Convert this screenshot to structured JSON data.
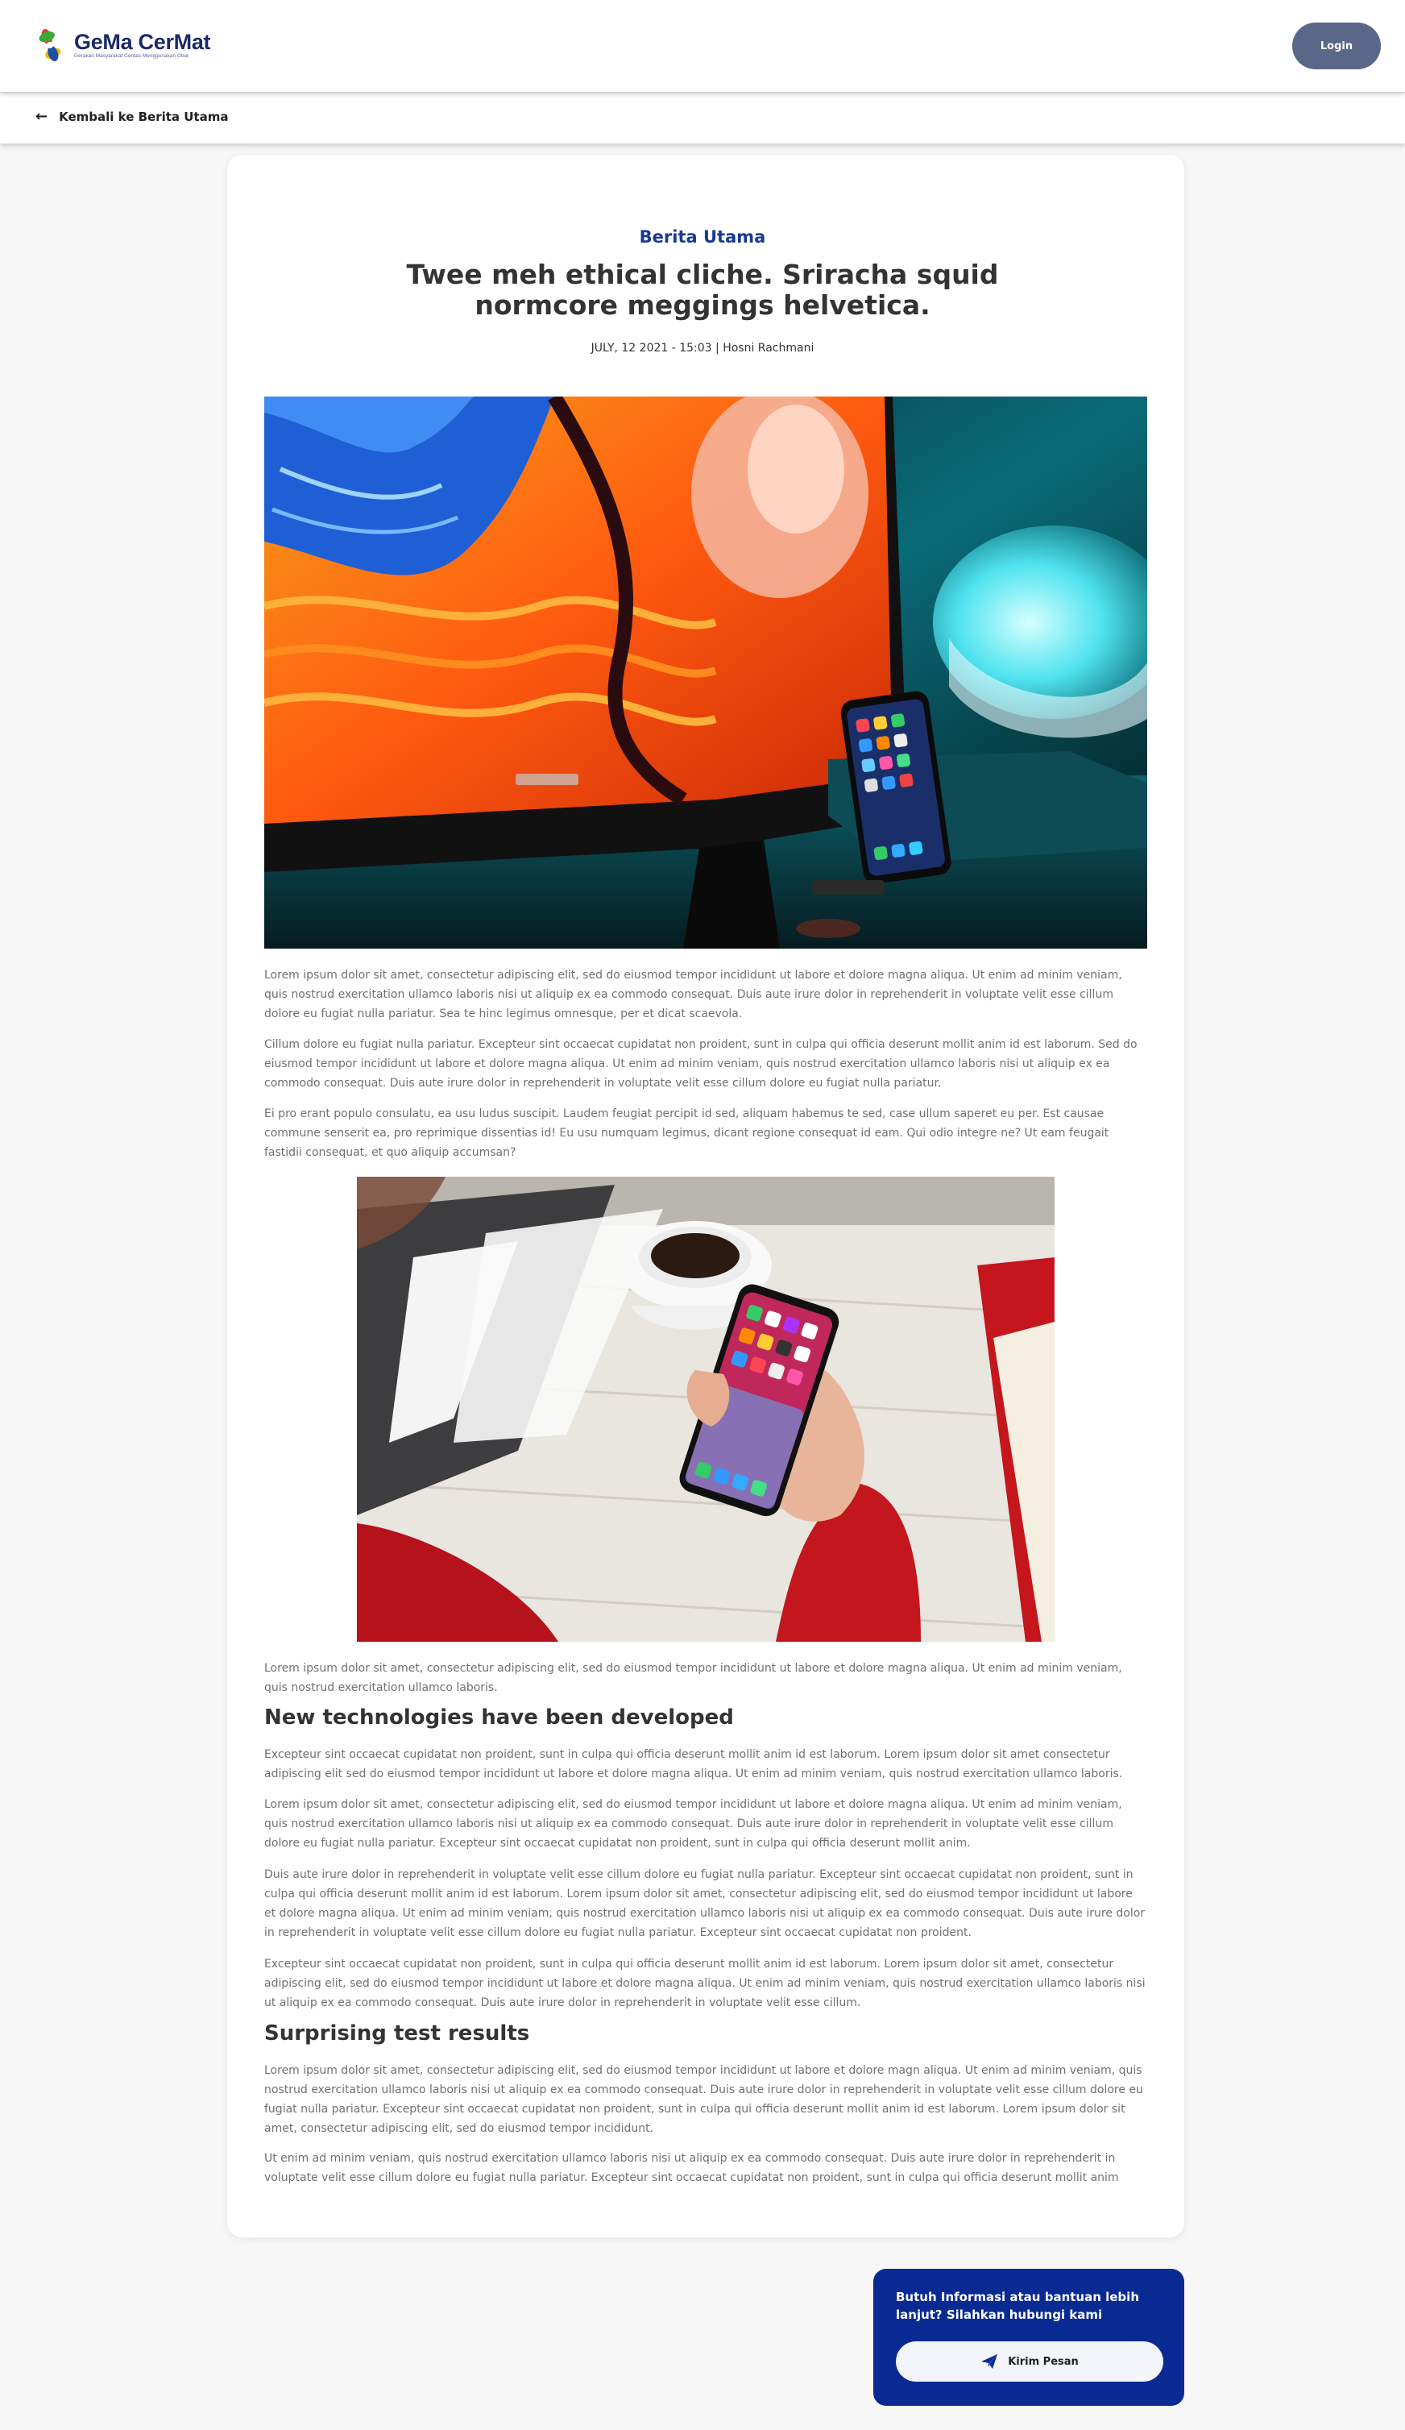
{
  "header": {
    "logo_name": "GeMa CerMat",
    "logo_tagline": "Gerakan Masyarakat Cerdas Menggunakan Obat",
    "login_label": "Login"
  },
  "nav": {
    "back_label": "Kembali ke Berita Utama"
  },
  "article": {
    "category": "Berita Utama",
    "title": "Twee meh ethical cliche. Sriracha squid normcore meggings helvetica.",
    "meta": "JULY, 12 2021 - 15:03 | Hosni Rachmani",
    "paragraphs": [
      "Lorem ipsum dolor sit amet, consectetur adipiscing elit, sed do eiusmod tempor incididunt ut labore et dolore magna aliqua. Ut enim ad minim veniam, quis nostrud exercitation ullamco laboris nisi ut aliquip ex ea commodo consequat. Duis aute irure dolor in reprehenderit in voluptate velit esse cillum dolore eu fugiat nulla pariatur. Sea te hinc legimus omnesque, per et dicat scaevola.",
      "Cillum dolore eu fugiat nulla pariatur. Excepteur sint occaecat cupidatat non proident, sunt in culpa qui officia deserunt mollit anim id est laborum. Sed do eiusmod tempor incididunt ut labore et dolore magna aliqua. Ut enim ad minim veniam, quis nostrud exercitation ullamco laboris nisi ut aliquip ex ea commodo consequat. Duis aute irure dolor in reprehenderit in voluptate velit esse cillum dolore eu fugiat nulla pariatur.",
      "Ei pro erant populo consulatu, ea usu ludus suscipit. Laudem feugiat percipit id sed, aliquam habemus te sed, case ullum saperet eu per. Est causae commune senserit ea, pro reprimique dissentias id! Eu usu numquam legimus, dicant regione consequat id eam. Qui odio integre ne? Ut eam feugait fastidii consequat, et quo aliquip accumsan?",
      "Lorem ipsum dolor sit amet, consectetur adipiscing elit, sed do eiusmod tempor incididunt ut labore et dolore magna aliqua. Ut enim ad minim veniam, quis nostrud exercitation ullamco laboris."
    ],
    "heading1": "New technologies have been developed",
    "section1": [
      "Excepteur sint occaecat cupidatat non proident, sunt in culpa qui officia deserunt mollit anim id est laborum. Lorem ipsum dolor sit amet consectetur adipiscing elit sed do eiusmod tempor incididunt ut labore et dolore magna aliqua. Ut enim ad minim veniam, quis nostrud exercitation ullamco laboris.",
      "Lorem ipsum dolor sit amet, consectetur adipiscing elit, sed do eiusmod tempor incididunt ut labore et dolore magna aliqua. Ut enim ad minim veniam, quis nostrud exercitation ullamco laboris nisi ut aliquip ex ea commodo consequat. Duis aute irure dolor in reprehenderit in voluptate velit esse cillum dolore eu fugiat nulla pariatur. Excepteur sint occaecat cupidatat non proident, sunt in culpa qui officia deserunt mollit anim.",
      "Duis aute irure dolor in reprehenderit in voluptate velit esse cillum dolore eu fugiat nulla pariatur. Excepteur sint occaecat cupidatat non proident, sunt in culpa qui officia deserunt mollit anim id est laborum. Lorem ipsum dolor sit amet, consectetur adipiscing elit, sed do eiusmod tempor incididunt ut labore et dolore magna aliqua. Ut enim ad minim veniam, quis nostrud exercitation ullamco laboris nisi ut aliquip ex ea commodo consequat. Duis aute irure dolor in reprehenderit in voluptate velit esse cillum dolore eu fugiat nulla pariatur. Excepteur sint occaecat cupidatat non proident.",
      "Excepteur sint occaecat cupidatat non proident, sunt in culpa qui officia deserunt mollit anim id est laborum. Lorem ipsum dolor sit amet, consectetur adipiscing elit, sed do eiusmod tempor incididunt ut labore et dolore magna aliqua. Ut enim ad minim veniam, quis nostrud exercitation ullamco laboris nisi ut aliquip ex ea commodo consequat. Duis aute irure dolor in reprehenderit in voluptate velit esse cillum."
    ],
    "heading2": "Surprising test results",
    "section2": [
      "Lorem ipsum dolor sit amet, consectetur adipiscing elit, sed do eiusmod tempor incididunt ut labore et dolore magn aliqua. Ut enim ad minim veniam, quis nostrud exercitation ullamco laboris nisi ut aliquip ex ea commodo consequat. Duis aute irure dolor in reprehenderit in voluptate velit esse cillum dolore eu fugiat nulla pariatur. Excepteur sint occaecat cupidatat non proident, sunt in culpa qui officia deserunt mollit anim id est laborum. Lorem ipsum dolor sit amet, consectetur adipiscing elit, sed do eiusmod tempor incididunt.",
      "Ut enim ad minim veniam, quis nostrud exercitation ullamco laboris nisi ut aliquip ex ea commodo consequat. Duis aute irure dolor in reprehenderit in voluptate velit esse cillum dolore eu fugiat nulla pariatur. Excepteur sint occaecat cupidatat non proident, sunt in culpa qui officia deserunt mollit anim"
    ]
  },
  "contact": {
    "text": "Butuh Informasi atau bantuan lebih lanjut? Silahkan hubungi kami",
    "button_label": "Kirim Pesan",
    "button_icon": "paper-plane-icon"
  },
  "colors": {
    "brand_navy": "#1b2a6b",
    "category_blue": "#1a3a8f",
    "contact_bg": "#0a2a93",
    "login_bg": "#5a6789"
  }
}
